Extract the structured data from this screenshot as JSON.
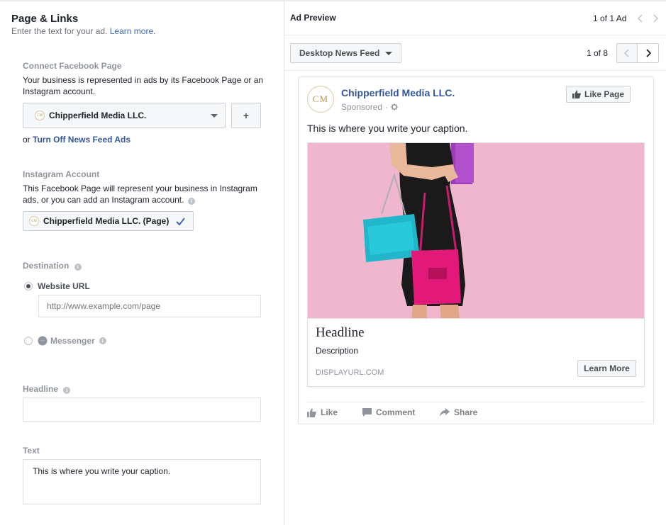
{
  "left": {
    "title": "Page & Links",
    "subtitle": "Enter the text for your ad.",
    "learn_more": "Learn more.",
    "connect": {
      "label": "Connect Facebook Page",
      "desc": "Your business is represented in ads by its Facebook Page or an Instagram account.",
      "page_name": "Chipperfield Media LLC.",
      "add_symbol": "+",
      "or_text": "or",
      "turn_off": "Turn Off News Feed Ads"
    },
    "instagram": {
      "label": "Instagram Account",
      "desc": "This Facebook Page will represent your business in Instagram ads, or you can add an Instagram account.",
      "account": "Chipperfield Media LLC. (Page)"
    },
    "destination": {
      "label": "Destination",
      "website_label": "Website URL",
      "website_placeholder": "http://www.example.com/page",
      "messenger_label": "Messenger"
    },
    "headline": {
      "label": "Headline",
      "value": ""
    },
    "text": {
      "label": "Text",
      "value": "This is where you write your caption."
    }
  },
  "right": {
    "title": "Ad Preview",
    "ad_count": "1 of 1 Ad",
    "placement": "Desktop News Feed",
    "placement_count": "1 of 8",
    "post": {
      "avatar_text": "CM",
      "page_name": "Chipperfield Media LLC.",
      "sponsored": "Sponsored",
      "like_page": "Like Page",
      "caption": "This is where you write your caption.",
      "headline": "Headline",
      "description": "Description",
      "display_url": "DISPLAYURL.COM",
      "cta": "Learn More",
      "like": "Like",
      "comment": "Comment",
      "share": "Share"
    }
  },
  "colors": {
    "link": "#4267b2",
    "page_link": "#365899",
    "muted": "#90949c",
    "photo_bg": "#f0b6ce"
  }
}
